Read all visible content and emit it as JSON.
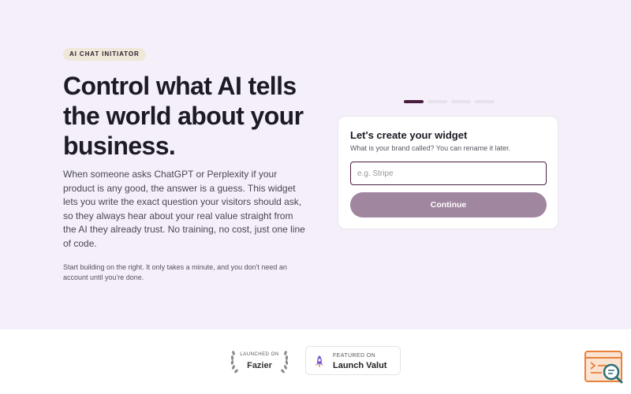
{
  "hero": {
    "badge": "AI CHAT INITIATOR",
    "headline": "Control what AI tells the world about your business.",
    "description": "When someone asks ChatGPT or Perplexity if your product is any good, the answer is a guess. This widget lets you write the exact question your visitors should ask, so they always hear about your real value straight from the AI they already trust. No training, no cost, just one line of code.",
    "note": "Start building on the right. It only takes a minute, and you don't need an account until you're done."
  },
  "wizard": {
    "steps_total": 4,
    "current_step": 1,
    "title": "Let's create your widget",
    "subtitle": "What is your brand called? You can rename it later.",
    "brand_input": {
      "value": "",
      "placeholder": "e.g. Stripe"
    },
    "continue_label": "Continue"
  },
  "footer": {
    "fazier": {
      "top": "LAUNCHED ON",
      "name": "Fazier"
    },
    "launch_valut": {
      "top": "FEATURED ON",
      "name": "Launch Valut"
    }
  },
  "colors": {
    "accent": "#4a1d3f",
    "button_disabled": "#a0869f",
    "hero_bg": "#f5effa",
    "badge_bg": "#efe7d8",
    "widget_orange": "#e8823a",
    "widget_teal": "#2f6f73"
  },
  "icons": {
    "fazier": "laurel-wreath-icon",
    "launch_valut": "rocket-icon",
    "help": "chat-search-icon"
  }
}
